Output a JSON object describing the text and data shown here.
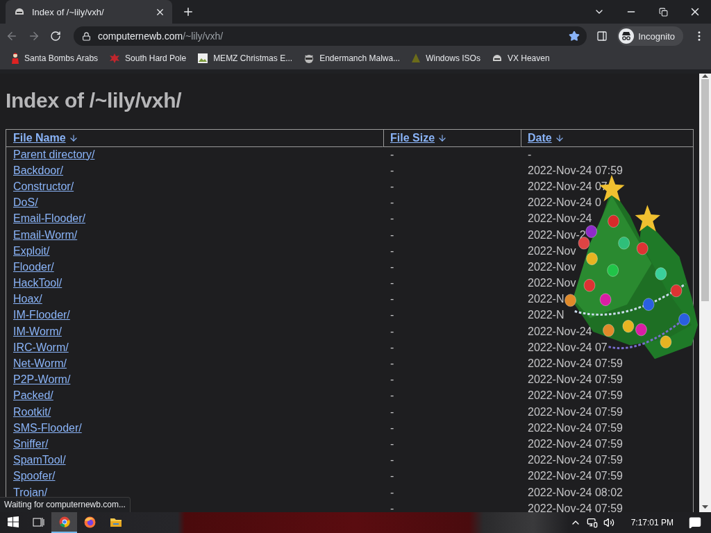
{
  "browser": {
    "tab": {
      "title": "Index of /~lily/vxh/"
    },
    "address": {
      "domain": "computernewb.com",
      "path": "/~lily/vxh/"
    },
    "starred": true,
    "profile": "Incognito",
    "bookmarks": [
      {
        "kind": "santa",
        "label": "Santa Bombs Arabs"
      },
      {
        "kind": "splat",
        "label": "South Hard Pole"
      },
      {
        "kind": "image",
        "label": "MEMZ Christmas E..."
      },
      {
        "kind": "animal",
        "label": "Endermanch Malwa..."
      },
      {
        "kind": "tree",
        "label": "Windows ISOs"
      },
      {
        "kind": "helmet",
        "label": "VX Heaven"
      }
    ]
  },
  "page": {
    "heading": "Index of /~lily/vxh/",
    "columns": [
      {
        "label": "File Name"
      },
      {
        "label": "File Size"
      },
      {
        "label": "Date"
      }
    ],
    "rows": [
      {
        "name": "Parent directory/",
        "size": "-",
        "date": "-"
      },
      {
        "name": "Backdoor/",
        "size": "-",
        "date": "2022-Nov-24 07:59"
      },
      {
        "name": "Constructor/",
        "size": "-",
        "date": "2022-Nov-24 07"
      },
      {
        "name": "DoS/",
        "size": "-",
        "date": "2022-Nov-24 0"
      },
      {
        "name": "Email-Flooder/",
        "size": "-",
        "date": "2022-Nov-24"
      },
      {
        "name": "Email-Worm/",
        "size": "-",
        "date": "2022-Nov-2"
      },
      {
        "name": "Exploit/",
        "size": "-",
        "date": "2022-Nov"
      },
      {
        "name": "Flooder/",
        "size": "-",
        "date": "2022-Nov"
      },
      {
        "name": "HackTool/",
        "size": "-",
        "date": "2022-Nov"
      },
      {
        "name": "Hoax/",
        "size": "-",
        "date": "2022-N"
      },
      {
        "name": "IM-Flooder/",
        "size": "-",
        "date": "2022-N"
      },
      {
        "name": "IM-Worm/",
        "size": "-",
        "date": "2022-Nov-24"
      },
      {
        "name": "IRC-Worm/",
        "size": "-",
        "date": "2022-Nov-24 07"
      },
      {
        "name": "Net-Worm/",
        "size": "-",
        "date": "2022-Nov-24 07:59"
      },
      {
        "name": "P2P-Worm/",
        "size": "-",
        "date": "2022-Nov-24 07:59"
      },
      {
        "name": "Packed/",
        "size": "-",
        "date": "2022-Nov-24 07:59"
      },
      {
        "name": "Rootkit/",
        "size": "-",
        "date": "2022-Nov-24 07:59"
      },
      {
        "name": "SMS-Flooder/",
        "size": "-",
        "date": "2022-Nov-24 07:59"
      },
      {
        "name": "Sniffer/",
        "size": "-",
        "date": "2022-Nov-24 07:59"
      },
      {
        "name": "SpamTool/",
        "size": "-",
        "date": "2022-Nov-24 07:59"
      },
      {
        "name": "Spoofer/",
        "size": "-",
        "date": "2022-Nov-24 07:59"
      },
      {
        "name": "Trojan/",
        "size": "-",
        "date": "2022-Nov-24 08:02"
      },
      {
        "size": "-",
        "date": "2022-Nov-24 07:59"
      }
    ]
  },
  "status": "Waiting for computernewb.com...",
  "taskbar": {
    "apps": [
      {
        "kind": "chrome",
        "selected": true
      },
      {
        "kind": "firefox",
        "selected": false
      },
      {
        "kind": "folder",
        "selected": false
      }
    ],
    "clock": "7:17:01 PM"
  }
}
